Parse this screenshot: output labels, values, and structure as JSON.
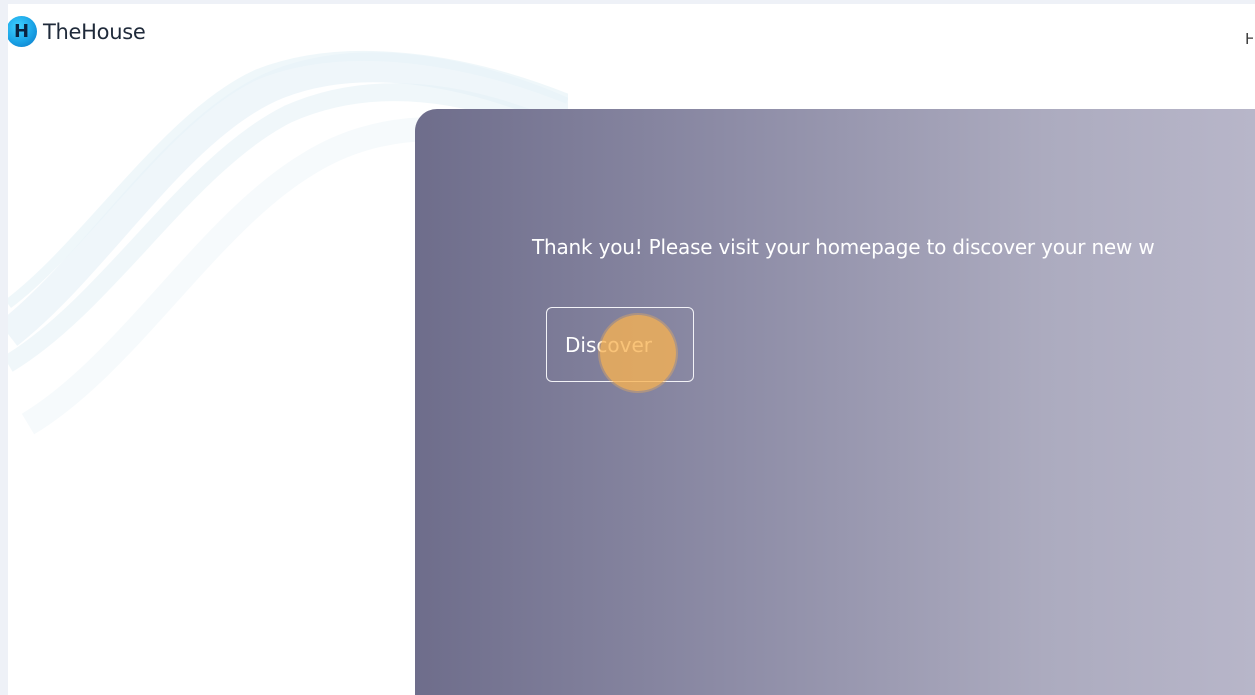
{
  "header": {
    "logo_letter": "H",
    "logo_text": "TheHouse",
    "nav_cut_label": "H"
  },
  "main": {
    "message": "Thank you! Please visit your homepage to discover your new w",
    "discover_button_label": "Discover"
  },
  "colors": {
    "panel_left": "#6e6d8b",
    "panel_right": "#bbb9cc",
    "logo_blue": "#1aa3e6",
    "click_highlight": "#f7b252"
  },
  "icons": {
    "logo": "house-logo-icon"
  }
}
